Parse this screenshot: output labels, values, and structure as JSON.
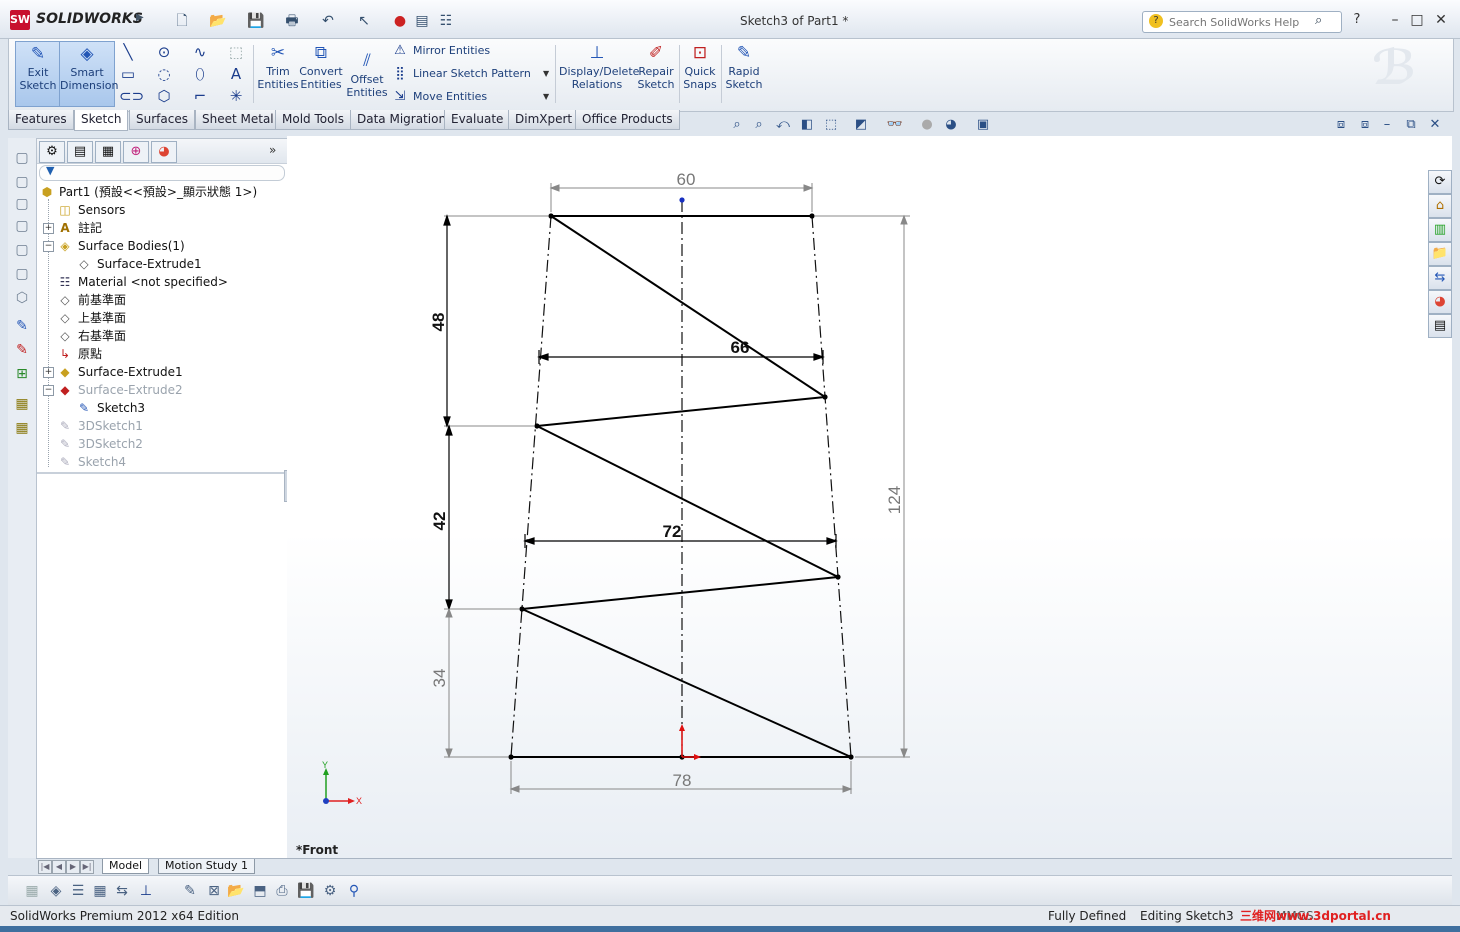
{
  "app": {
    "logo_letters": "SW",
    "logo_text": "SOLIDWORKS",
    "doc_title": "Sketch3 of Part1 *",
    "help_placeholder": "Search SolidWorks Help",
    "help_icon": "?",
    "window_controls": [
      "–",
      "□",
      "✕"
    ]
  },
  "quick_access": [
    "new-icon",
    "open-icon",
    "save-icon",
    "print-icon",
    "undo-icon",
    "select-icon",
    "rebuild-icon",
    "file-properties-icon",
    "options-icon"
  ],
  "command_manager": {
    "exit_sketch": [
      "Exit",
      "Sketch"
    ],
    "smart_dimension": [
      "Smart",
      "Dimension"
    ],
    "trim": [
      "Trim",
      "Entities"
    ],
    "convert": [
      "Convert",
      "Entities"
    ],
    "offset": [
      "Offset",
      "Entities"
    ],
    "mirror": "Mirror Entities",
    "linear_pattern": "Linear Sketch Pattern",
    "move": "Move Entities",
    "display_delete": [
      "Display/Delete",
      "Relations"
    ],
    "repair": [
      "Repair",
      "Sketch"
    ],
    "quick_snaps": [
      "Quick",
      "Snaps"
    ],
    "rapid_sketch": [
      "Rapid",
      "Sketch"
    ]
  },
  "tabs": [
    "Features",
    "Sketch",
    "Surfaces",
    "Sheet Metal",
    "Mold Tools",
    "Data Migration",
    "Evaluate",
    "DimXpert",
    "Office Products"
  ],
  "active_tab": "Sketch",
  "tree": {
    "root": "Part1  (預設<<預設>_顯示狀態 1>)",
    "items": [
      {
        "label": "Sensors",
        "icon": "sensors-icon"
      },
      {
        "label": "註記",
        "icon": "annotations-icon"
      },
      {
        "label": "Surface Bodies(1)",
        "icon": "surface-bodies-icon"
      },
      {
        "label": "Surface-Extrude1",
        "icon": "surface-body-icon"
      },
      {
        "label": "Material <not specified>",
        "icon": "material-icon"
      },
      {
        "label": "前基準面",
        "icon": "plane-icon"
      },
      {
        "label": "上基準面",
        "icon": "plane-icon"
      },
      {
        "label": "右基準面",
        "icon": "plane-icon"
      },
      {
        "label": "原點",
        "icon": "origin-icon"
      },
      {
        "label": "Surface-Extrude1",
        "icon": "surface-extrude-icon"
      },
      {
        "label": "Surface-Extrude2",
        "icon": "surface-extrude-icon"
      },
      {
        "label": "Sketch3",
        "icon": "sketch-icon"
      },
      {
        "label": "3DSketch1",
        "icon": "3dsketch-icon"
      },
      {
        "label": "3DSketch2",
        "icon": "3dsketch-icon"
      },
      {
        "label": "Sketch4",
        "icon": "sketch-icon"
      }
    ]
  },
  "bottom_tabs": [
    "Model",
    "Motion Study 1"
  ],
  "sheet_label": "*Front",
  "triad": {
    "y": "Y",
    "x": "X"
  },
  "dimensions": {
    "top": "60",
    "d66": "66",
    "d72": "72",
    "bottom": "78",
    "h48": "48",
    "h42": "42",
    "h34": "34",
    "h124": "124"
  },
  "status": {
    "edition": "SolidWorks Premium 2012 x64 Edition",
    "defined": "Fully Defined",
    "editing": "Editing Sketch3",
    "units": "MMGS"
  },
  "watermark": "三维网www.3dportal.cn"
}
